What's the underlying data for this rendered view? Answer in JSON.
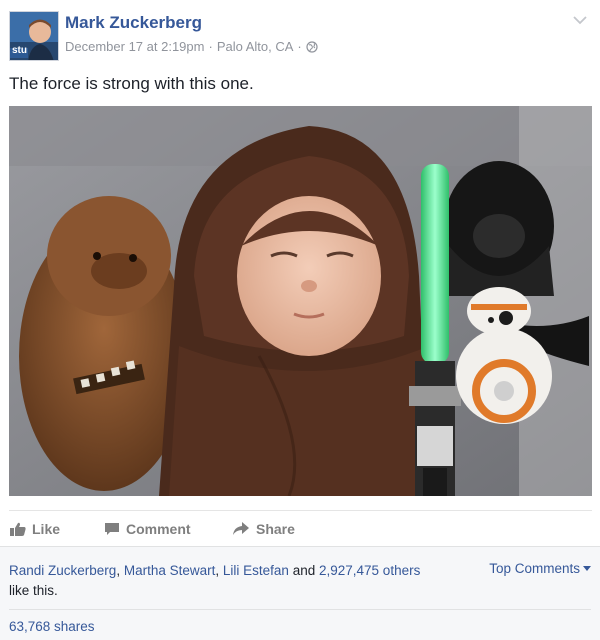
{
  "author": {
    "name": "Mark Zuckerberg",
    "avatar_badge": "stu",
    "avatar_icon": "profile-photo"
  },
  "post": {
    "date": "December 17 at 2:19pm",
    "separator": "·",
    "location": "Palo Alto, CA",
    "privacy_icon": "globe-icon",
    "text": "The force is strong with this one."
  },
  "actions": {
    "like": "Like",
    "comment": "Comment",
    "share": "Share"
  },
  "reactions": {
    "liker_1": "Randi Zuckerberg",
    "liker_2": "Martha Stewart",
    "liker_3": "Lili Estefan",
    "and_word": "and",
    "others": "2,927,475 others",
    "suffix": "like this.",
    "top_comments": "Top Comments",
    "shares": "63,768 shares"
  },
  "colors": {
    "link": "#365899",
    "muted": "#90949c",
    "action": "#7f7f7f",
    "footer_bg": "#f6f7f9"
  }
}
